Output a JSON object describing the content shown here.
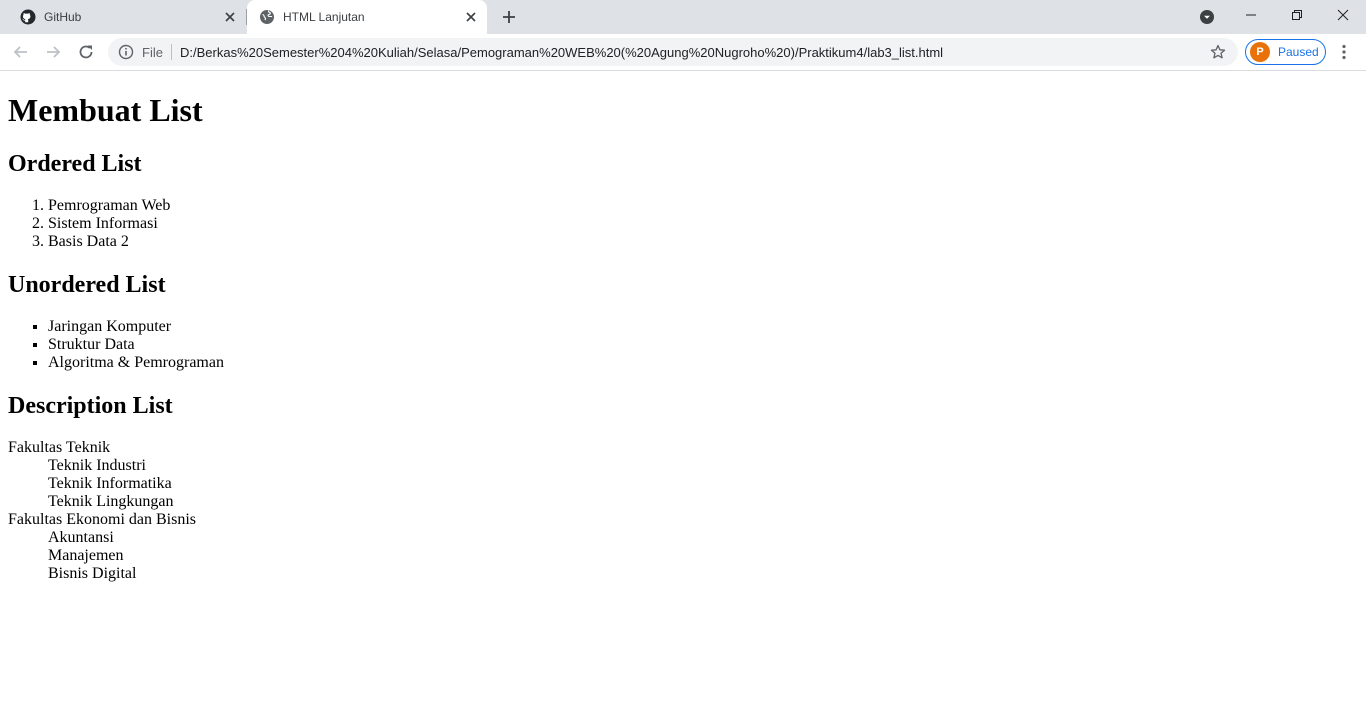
{
  "tabs": [
    {
      "title": "GitHub",
      "icon": "github-icon",
      "active": false
    },
    {
      "title": "HTML Lanjutan",
      "icon": "globe-icon",
      "active": true
    }
  ],
  "toolbar": {
    "file_label": "File",
    "url": "D:/Berkas%20Semester%204%20Kuliah/Selasa/Pemograman%20WEB%20(%20Agung%20Nugroho%20)/Praktikum4/lab3_list.html",
    "profile_initial": "P",
    "profile_label": "Paused"
  },
  "colors": {
    "tabstrip": "#dee1e6",
    "omnibox": "#f1f3f4",
    "accent": "#1a73e8",
    "avatar": "#e8710a"
  },
  "page": {
    "title": "Membuat List",
    "ordered": {
      "heading": "Ordered List",
      "items": [
        "Pemrograman Web",
        "Sistem Informasi",
        "Basis Data 2"
      ]
    },
    "unordered": {
      "heading": "Unordered List",
      "items": [
        "Jaringan Komputer",
        "Struktur Data",
        "Algoritma & Pemrograman"
      ]
    },
    "description": {
      "heading": "Description List",
      "groups": [
        {
          "term": "Fakultas Teknik",
          "defs": [
            "Teknik Industri",
            "Teknik Informatika",
            "Teknik Lingkungan"
          ]
        },
        {
          "term": "Fakultas Ekonomi dan Bisnis",
          "defs": [
            "Akuntansi",
            "Manajemen",
            "Bisnis Digital"
          ]
        }
      ]
    }
  }
}
